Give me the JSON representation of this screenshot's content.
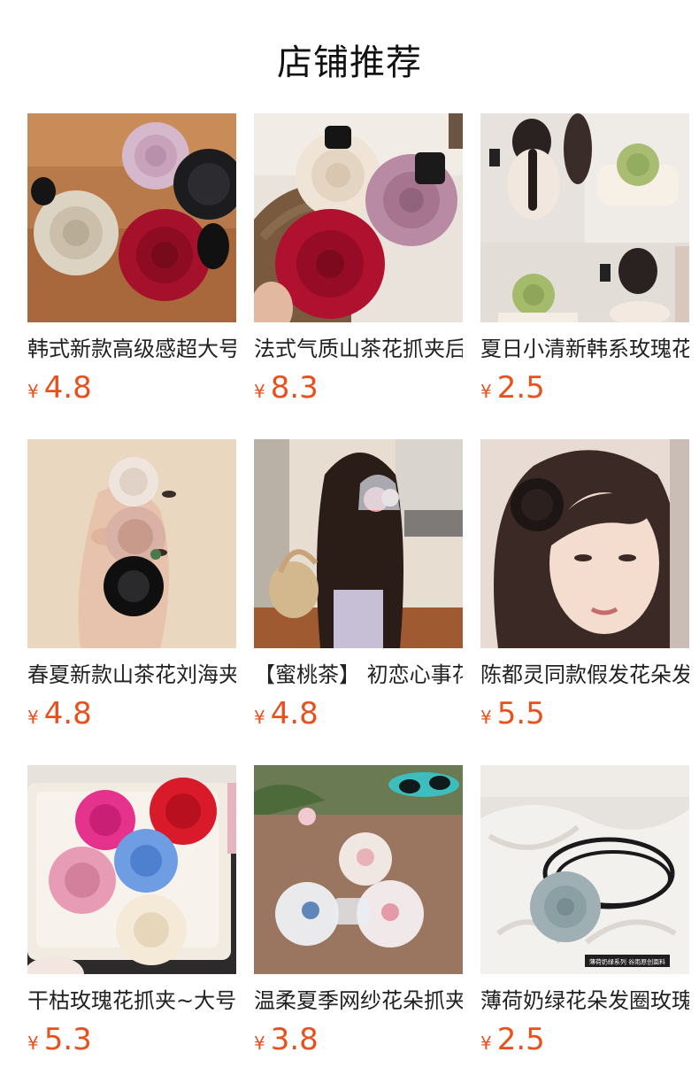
{
  "header": {
    "title": "店铺推荐"
  },
  "products": [
    {
      "name": "韩式新款高级感超大号玫瑰花抓夹",
      "currency": "¥",
      "price": "4.8"
    },
    {
      "name": "法式气质山茶花抓夹后脑勺发夹",
      "currency": "¥",
      "price": "8.3"
    },
    {
      "name": "夏日小清新韩系玫瑰花发圈",
      "currency": "¥",
      "price": "2.5"
    },
    {
      "name": "春夏新款山茶花刘海夹边夹",
      "currency": "¥",
      "price": "4.8"
    },
    {
      "name": "【蜜桃茶】 初恋心事花朵抓夹",
      "currency": "¥",
      "price": "4.8"
    },
    {
      "name": "陈都灵同款假发花朵发夹",
      "currency": "¥",
      "price": "5.5"
    },
    {
      "name": "干枯玫瑰花抓夹~大号鲨鱼夹",
      "currency": "¥",
      "price": "5.3"
    },
    {
      "name": "温柔夏季网纱花朵抓夹",
      "currency": "¥",
      "price": "3.8"
    },
    {
      "name": "薄荷奶绿花朵发圈玫瑰头绳",
      "currency": "¥",
      "price": "2.5"
    }
  ],
  "image_captions": {
    "product_9_caption": "薄荷奶绿系列 谷雨原创面料"
  }
}
